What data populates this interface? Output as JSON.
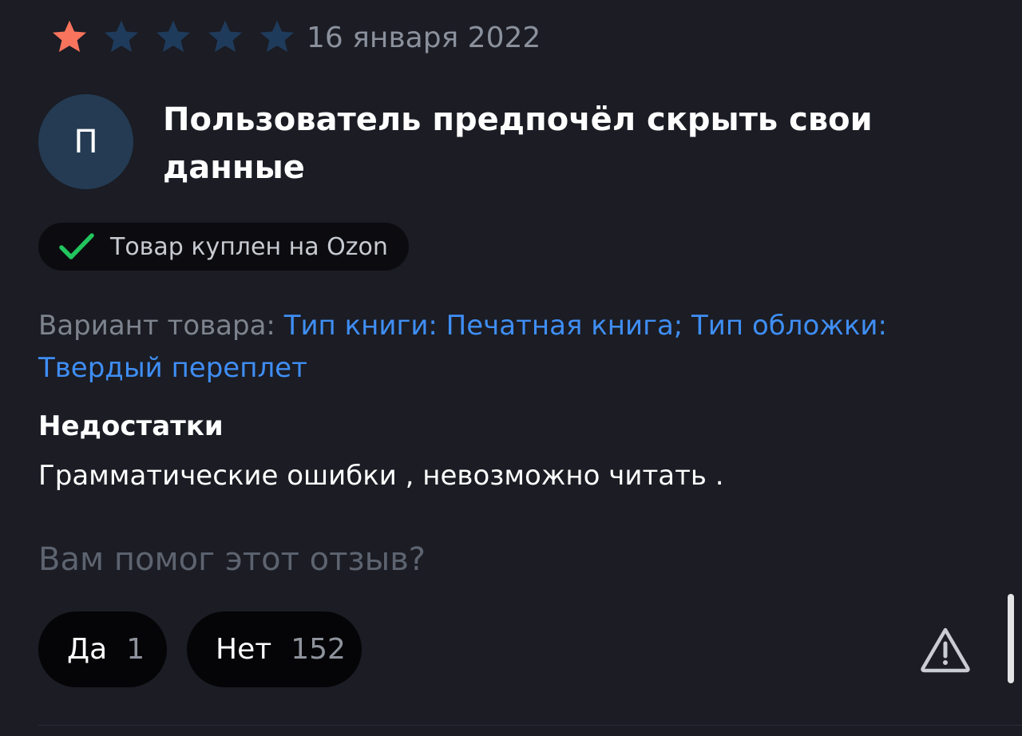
{
  "review": {
    "rating": 1,
    "max_rating": 5,
    "date": "16 января 2022",
    "avatar_letter": "П",
    "author_name": "Пользователь предпочёл скрыть свои данные",
    "verified_label": "Товар куплен на Ozon",
    "variant_label": "Вариант товара:",
    "variant_value": "Тип книги: Печатная книга; Тип обложки: Твердый переплет",
    "cons_title": "Недостатки",
    "cons_text": "Грамматические ошибки , невозможно читать ."
  },
  "helpful": {
    "question": "Вам помог этот отзыв?",
    "yes_label": "Да",
    "yes_count": "1",
    "no_label": "Нет",
    "no_count": "152"
  },
  "icons": {
    "star_filled": "star-icon",
    "star_empty": "star-outline-icon",
    "verified": "checkmark-icon",
    "report": "warning-triangle-icon"
  },
  "colors": {
    "background": "#1b1c24",
    "star_active": "#f8745c",
    "star_inactive": "#1f3b5c",
    "link_blue": "#3f8ef4",
    "check_green": "#22c55e",
    "avatar_bg": "#243b53"
  }
}
